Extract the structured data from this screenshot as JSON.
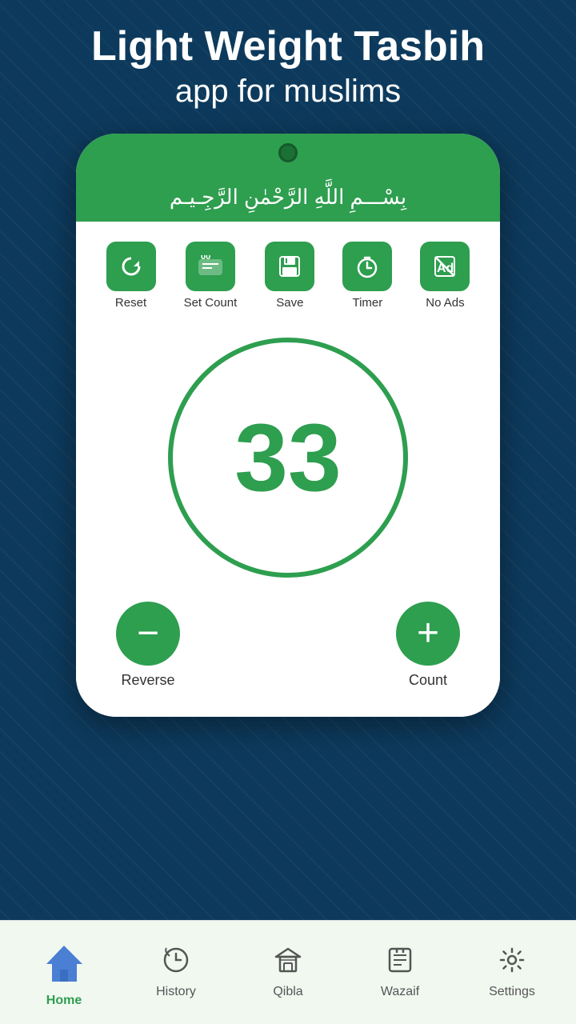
{
  "header": {
    "line1": "Light Weight Tasbih",
    "line2": "app  for muslims"
  },
  "phone": {
    "arabic_text": "بِسْـــمِ اللَّهِ الرَّحْمٰنِ الرَّجِـيـم",
    "counter": "33",
    "action_buttons": [
      {
        "id": "reset",
        "icon": "↺",
        "label": "Reset"
      },
      {
        "id": "set-count",
        "icon": "💰",
        "label": "Set Count"
      },
      {
        "id": "save",
        "icon": "💾",
        "label": "Save"
      },
      {
        "id": "timer",
        "icon": "⏱",
        "label": "Timer"
      },
      {
        "id": "no-ads",
        "icon": "🚫",
        "label": "No Ads"
      }
    ],
    "controls": {
      "reverse_label": "Reverse",
      "count_label": "Count"
    }
  },
  "nav": {
    "items": [
      {
        "id": "home",
        "label": "Home",
        "icon": "home",
        "active": true
      },
      {
        "id": "history",
        "label": "History",
        "icon": "history",
        "active": false
      },
      {
        "id": "qibla",
        "label": "Qibla",
        "icon": "qibla",
        "active": false
      },
      {
        "id": "wazaif",
        "label": "Wazaif",
        "icon": "wazaif",
        "active": false
      },
      {
        "id": "settings",
        "label": "Settings",
        "icon": "settings",
        "active": false
      }
    ]
  }
}
